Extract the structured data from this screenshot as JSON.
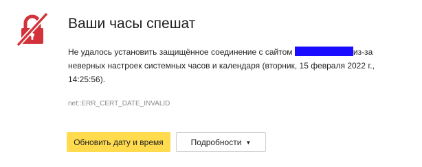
{
  "header": {
    "title": "Ваши часы спешат",
    "icon": "broken-lock-icon",
    "icon_color": "#d3323a"
  },
  "message": {
    "before_site": "Не удалось установить защищённое соединение с сайтом",
    "after_site": "из-за неверных настроек системных часов и календаря (вторник, 15 февраля 2022 г., 14:25:56)."
  },
  "error_code": "net::ERR_CERT_DATE_INVALID",
  "buttons": {
    "update_label": "Обновить дату и время",
    "details_label": "Подробности",
    "details_caret": "▼"
  },
  "colors": {
    "primary_button": "#ffdb4d",
    "redaction": "#1a0dff"
  }
}
